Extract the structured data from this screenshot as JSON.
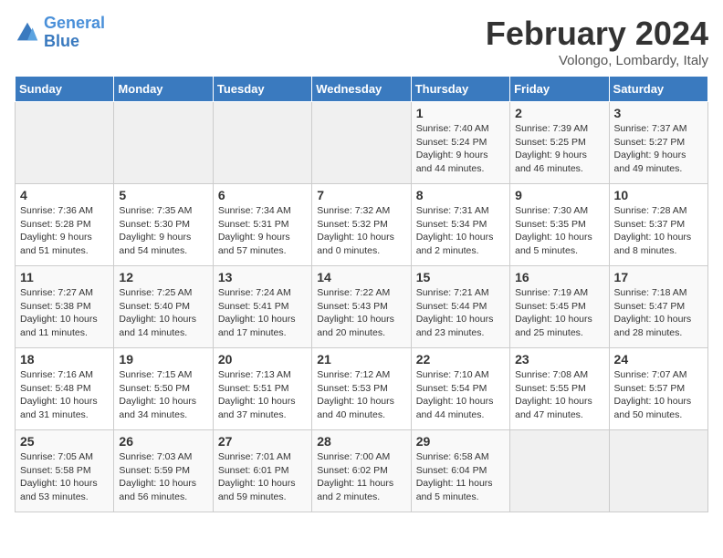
{
  "header": {
    "logo_line1": "General",
    "logo_line2": "Blue",
    "month": "February 2024",
    "location": "Volongo, Lombardy, Italy"
  },
  "days_of_week": [
    "Sunday",
    "Monday",
    "Tuesday",
    "Wednesday",
    "Thursday",
    "Friday",
    "Saturday"
  ],
  "weeks": [
    [
      {
        "day": "",
        "info": ""
      },
      {
        "day": "",
        "info": ""
      },
      {
        "day": "",
        "info": ""
      },
      {
        "day": "",
        "info": ""
      },
      {
        "day": "1",
        "info": "Sunrise: 7:40 AM\nSunset: 5:24 PM\nDaylight: 9 hours\nand 44 minutes."
      },
      {
        "day": "2",
        "info": "Sunrise: 7:39 AM\nSunset: 5:25 PM\nDaylight: 9 hours\nand 46 minutes."
      },
      {
        "day": "3",
        "info": "Sunrise: 7:37 AM\nSunset: 5:27 PM\nDaylight: 9 hours\nand 49 minutes."
      }
    ],
    [
      {
        "day": "4",
        "info": "Sunrise: 7:36 AM\nSunset: 5:28 PM\nDaylight: 9 hours\nand 51 minutes."
      },
      {
        "day": "5",
        "info": "Sunrise: 7:35 AM\nSunset: 5:30 PM\nDaylight: 9 hours\nand 54 minutes."
      },
      {
        "day": "6",
        "info": "Sunrise: 7:34 AM\nSunset: 5:31 PM\nDaylight: 9 hours\nand 57 minutes."
      },
      {
        "day": "7",
        "info": "Sunrise: 7:32 AM\nSunset: 5:32 PM\nDaylight: 10 hours\nand 0 minutes."
      },
      {
        "day": "8",
        "info": "Sunrise: 7:31 AM\nSunset: 5:34 PM\nDaylight: 10 hours\nand 2 minutes."
      },
      {
        "day": "9",
        "info": "Sunrise: 7:30 AM\nSunset: 5:35 PM\nDaylight: 10 hours\nand 5 minutes."
      },
      {
        "day": "10",
        "info": "Sunrise: 7:28 AM\nSunset: 5:37 PM\nDaylight: 10 hours\nand 8 minutes."
      }
    ],
    [
      {
        "day": "11",
        "info": "Sunrise: 7:27 AM\nSunset: 5:38 PM\nDaylight: 10 hours\nand 11 minutes."
      },
      {
        "day": "12",
        "info": "Sunrise: 7:25 AM\nSunset: 5:40 PM\nDaylight: 10 hours\nand 14 minutes."
      },
      {
        "day": "13",
        "info": "Sunrise: 7:24 AM\nSunset: 5:41 PM\nDaylight: 10 hours\nand 17 minutes."
      },
      {
        "day": "14",
        "info": "Sunrise: 7:22 AM\nSunset: 5:43 PM\nDaylight: 10 hours\nand 20 minutes."
      },
      {
        "day": "15",
        "info": "Sunrise: 7:21 AM\nSunset: 5:44 PM\nDaylight: 10 hours\nand 23 minutes."
      },
      {
        "day": "16",
        "info": "Sunrise: 7:19 AM\nSunset: 5:45 PM\nDaylight: 10 hours\nand 25 minutes."
      },
      {
        "day": "17",
        "info": "Sunrise: 7:18 AM\nSunset: 5:47 PM\nDaylight: 10 hours\nand 28 minutes."
      }
    ],
    [
      {
        "day": "18",
        "info": "Sunrise: 7:16 AM\nSunset: 5:48 PM\nDaylight: 10 hours\nand 31 minutes."
      },
      {
        "day": "19",
        "info": "Sunrise: 7:15 AM\nSunset: 5:50 PM\nDaylight: 10 hours\nand 34 minutes."
      },
      {
        "day": "20",
        "info": "Sunrise: 7:13 AM\nSunset: 5:51 PM\nDaylight: 10 hours\nand 37 minutes."
      },
      {
        "day": "21",
        "info": "Sunrise: 7:12 AM\nSunset: 5:53 PM\nDaylight: 10 hours\nand 40 minutes."
      },
      {
        "day": "22",
        "info": "Sunrise: 7:10 AM\nSunset: 5:54 PM\nDaylight: 10 hours\nand 44 minutes."
      },
      {
        "day": "23",
        "info": "Sunrise: 7:08 AM\nSunset: 5:55 PM\nDaylight: 10 hours\nand 47 minutes."
      },
      {
        "day": "24",
        "info": "Sunrise: 7:07 AM\nSunset: 5:57 PM\nDaylight: 10 hours\nand 50 minutes."
      }
    ],
    [
      {
        "day": "25",
        "info": "Sunrise: 7:05 AM\nSunset: 5:58 PM\nDaylight: 10 hours\nand 53 minutes."
      },
      {
        "day": "26",
        "info": "Sunrise: 7:03 AM\nSunset: 5:59 PM\nDaylight: 10 hours\nand 56 minutes."
      },
      {
        "day": "27",
        "info": "Sunrise: 7:01 AM\nSunset: 6:01 PM\nDaylight: 10 hours\nand 59 minutes."
      },
      {
        "day": "28",
        "info": "Sunrise: 7:00 AM\nSunset: 6:02 PM\nDaylight: 11 hours\nand 2 minutes."
      },
      {
        "day": "29",
        "info": "Sunrise: 6:58 AM\nSunset: 6:04 PM\nDaylight: 11 hours\nand 5 minutes."
      },
      {
        "day": "",
        "info": ""
      },
      {
        "day": "",
        "info": ""
      }
    ]
  ]
}
